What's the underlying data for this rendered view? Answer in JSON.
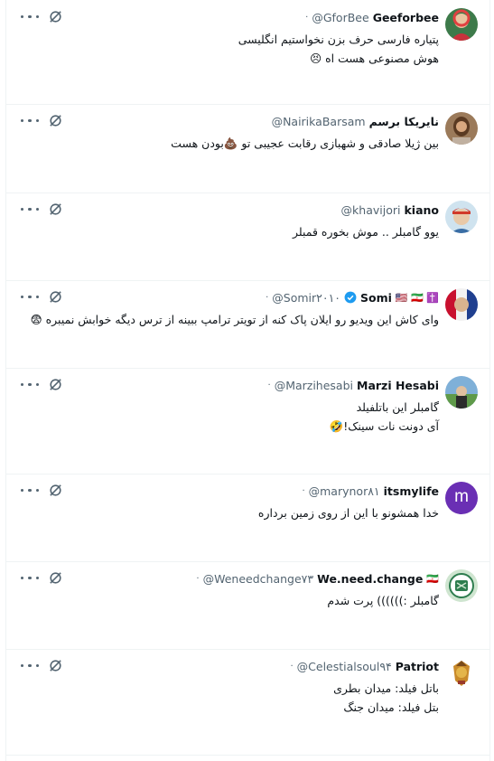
{
  "tweets": [
    {
      "name": "Geeforbee",
      "handle": "@GforBee",
      "lines": [
        "پتیاره فارسی حرف بزن نخواستیم انگلیسی",
        "هوش مصنوعی هست  اه 😣"
      ]
    },
    {
      "name": "نایریکا برسم",
      "handle": "@NairikaBarsam",
      "lines": [
        "بین ژیلا صادقی و شهبازی رقابت عجیبی تو 💩بودن هست"
      ]
    },
    {
      "name": "kiano",
      "handle": "@khavijori",
      "lines": [
        "یوو گامبلر .. موش بخوره قمبلر"
      ]
    },
    {
      "name": "Somi",
      "handle": "@Somir۲۰۱۰",
      "flags": "🇺🇸 🇮🇷 ✝️",
      "lines": [
        "وای کاش این ویدیو رو ایلان پاک کنه از تویتر ترامپ ببینه از ترس دیگه خوابش نمیبره 😨"
      ]
    },
    {
      "name": "Marzi Hesabi",
      "handle": "@Marzihesabi",
      "lines": [
        "گامبلر این باتلفیلد",
        "آی دونت نات سینک!🤣"
      ]
    },
    {
      "name": "itsmylife",
      "handle": "@marynor۸۱",
      "avatar_letter": "m",
      "lines": [
        "خدا همشونو با این از روی زمین برداره"
      ]
    },
    {
      "name": "We.need.change",
      "handle": "@Weneedchange۷۳",
      "flags": "🇮🇷",
      "lines": [
        "گامبلر :)))))) پرت شدم"
      ]
    },
    {
      "name": "Patriot",
      "handle": "@Celestialsoul۹۴",
      "lines": [
        "باتل فیلد: میدان بطری",
        "بتل فیلد: میدان جنگ"
      ]
    }
  ],
  "icons": {
    "more": "more-icon",
    "grok": "grok-icon",
    "verified": "verified-badge-icon"
  },
  "colors": {
    "text": "#0f1419",
    "secondary": "#536471",
    "divider": "#eff3f4",
    "verified": "#1d9bf0",
    "avatar_purple": "#6a2fb4"
  }
}
